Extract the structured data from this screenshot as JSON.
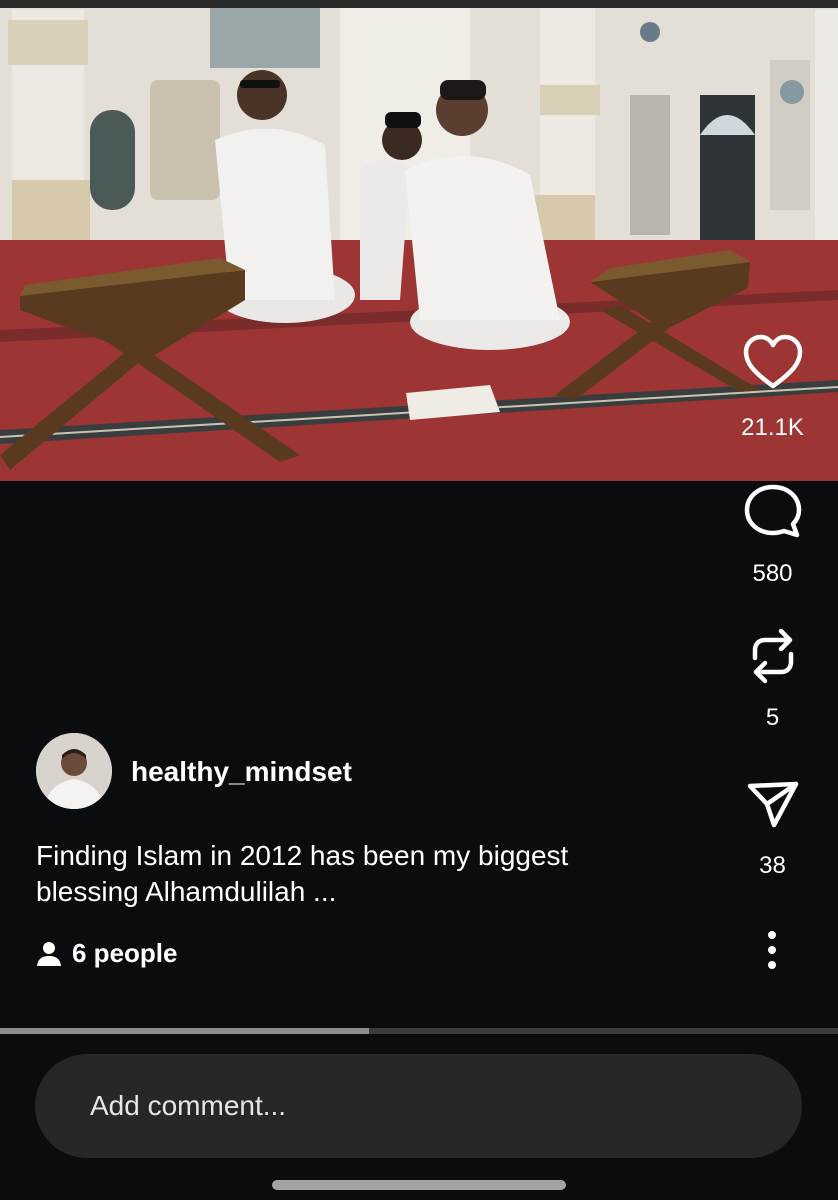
{
  "post": {
    "image_alt": "Men praying in a mosque",
    "username": "healthy_mindset",
    "caption_line1": "Finding Islam in 2012 has been my biggest",
    "caption_line2": "blessing Alhamdulilah ...",
    "people_label": "6 people",
    "video_progress": 0.44
  },
  "actions": {
    "like_count": "21.1K",
    "comment_count": "580",
    "repost_count": "5",
    "share_count": "38"
  },
  "icons": {
    "like": "heart-icon",
    "comment": "comment-bubble-icon",
    "repost": "repost-icon",
    "share": "send-icon",
    "more": "more-vertical-icon",
    "people": "person-icon"
  },
  "comment": {
    "placeholder": "Add comment..."
  },
  "colors": {
    "background": "#0b0c0f",
    "comment_box": "#26272b",
    "carpet": "#9b3434"
  }
}
